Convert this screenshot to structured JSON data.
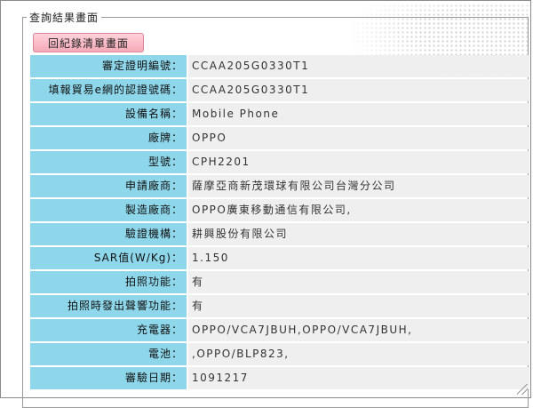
{
  "panel": {
    "title": "查詢結果畫面"
  },
  "back_button": {
    "label": "回紀錄清單畫面"
  },
  "rows": [
    {
      "label": "審定證明編號：",
      "value": "CCAA205G0330T1"
    },
    {
      "label": "填報貿易e網的認證號碼：",
      "value": "CCAA205G0330T1"
    },
    {
      "label": "設備名稱：",
      "value": "Mobile Phone"
    },
    {
      "label": "廠牌：",
      "value": "OPPO"
    },
    {
      "label": "型號：",
      "value": "CPH2201"
    },
    {
      "label": "申請廠商：",
      "value": "薩摩亞商新茂環球有限公司台灣分公司"
    },
    {
      "label": "製造廠商：",
      "value": "OPPO廣東移動通信有限公司,"
    },
    {
      "label": "驗證機構：",
      "value": "耕興股份有限公司"
    },
    {
      "label": "SAR值(W/Kg)：",
      "value": "1.150"
    },
    {
      "label": "拍照功能：",
      "value": "有"
    },
    {
      "label": "拍照時發出聲響功能：",
      "value": "有"
    },
    {
      "label": "充電器：",
      "value": "OPPO/VCA7JBUH,OPPO/VCA7JBUH,"
    },
    {
      "label": "電池：",
      "value": ",OPPO/BLP823,"
    },
    {
      "label": "審驗日期：",
      "value": "1091217"
    }
  ],
  "colors": {
    "label_bg": "#8ed7eb",
    "value_bg": "#efefef",
    "button_bg": "#f5a9b7"
  }
}
